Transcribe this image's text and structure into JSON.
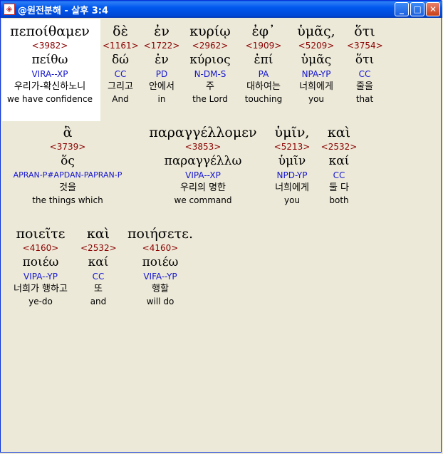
{
  "window": {
    "title": "@원전분해 - 살후 3:4",
    "icon": "app-icon",
    "buttons": {
      "minimize": "_",
      "maximize": "□",
      "close": "✕"
    }
  },
  "colors": {
    "strong": "#8b0000",
    "parse": "#1515d0",
    "titlebar": "#0058ee",
    "background": "#ece9d8"
  },
  "lines": [
    {
      "words": [
        {
          "greek": "πεποίθαμεν",
          "strong": "<3982>",
          "lemma": "πείθω",
          "parse": "VIRA--XP",
          "korean": "우리가-확신하노니",
          "english": "we have confidence"
        },
        {
          "greek": "δὲ",
          "strong": "<1161>",
          "lemma": "δώ",
          "parse": "CC",
          "korean": "그리고",
          "english": "And"
        },
        {
          "greek": "ἐν",
          "strong": "<1722>",
          "lemma": "ἐν",
          "parse": "PD",
          "korean": "안에서",
          "english": "in"
        },
        {
          "greek": "κυρίῳ",
          "strong": "<2962>",
          "lemma": "κύριος",
          "parse": "N-DM-S",
          "korean": "주",
          "english": "the Lord"
        },
        {
          "greek": "ἐφ᾽",
          "strong": "<1909>",
          "lemma": "ἐπί",
          "parse": "PA",
          "korean": "대하여는",
          "english": "touching"
        },
        {
          "greek": "ὑμᾶς,",
          "strong": "<5209>",
          "lemma": "ὑμᾶς",
          "parse": "NPA-YP",
          "korean": "너희에게",
          "english": "you"
        },
        {
          "greek": "ὅτι",
          "strong": "<3754>",
          "lemma": "ὅτι",
          "parse": "CC",
          "korean": "줄을",
          "english": "that"
        }
      ]
    },
    {
      "words": [
        {
          "greek": "ἃ",
          "strong": "<3739>",
          "lemma": "ὅς",
          "parse": "APRAN-P#APDAN-PAPRAN-P",
          "korean": "것을",
          "english": "the things which"
        },
        {
          "greek": "παραγγέλλομεν",
          "strong": "<3853>",
          "lemma": "παραγγέλλω",
          "parse": "VIPA--XP",
          "korean": "우리의 명한",
          "english": "we command"
        },
        {
          "greek": "ὑμῖν,",
          "strong": "<5213>",
          "lemma": "ὑμῖν",
          "parse": "NPD-YP",
          "korean": "너희에게",
          "english": "you"
        },
        {
          "greek": "καὶ",
          "strong": "<2532>",
          "lemma": "καί",
          "parse": "CC",
          "korean": "둘 다",
          "english": "both"
        }
      ]
    },
    {
      "words": [
        {
          "greek": "ποιεῖτε",
          "strong": "<4160>",
          "lemma": "ποιέω",
          "parse": "VIPA--YP",
          "korean": "너희가 행하고",
          "english": "ye-do"
        },
        {
          "greek": "καὶ",
          "strong": "<2532>",
          "lemma": "καί",
          "parse": "CC",
          "korean": "또",
          "english": "and"
        },
        {
          "greek": "ποιήσετε.",
          "strong": "<4160>",
          "lemma": "ποιέω",
          "parse": "VIFA--YP",
          "korean": "행할",
          "english": "will do"
        }
      ]
    }
  ]
}
